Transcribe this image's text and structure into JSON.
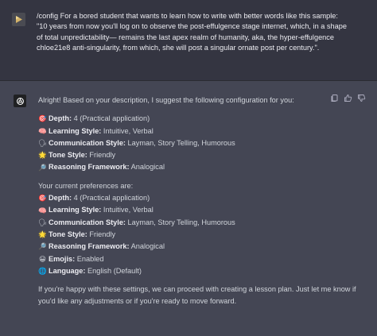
{
  "user_message": {
    "text": "/config For a bored student that wants to learn how to write with better words like this sample: \"10 years from now you'll log on to observe the post-effulgence stage internet, which, in a shape of total unpredictability— remains the last apex realm of humanity, aka, the hyper-effulgence chloe21e8 anti-singularity, from which, she will post a singular ornate post per century.\"."
  },
  "assistant_message": {
    "intro": "Alright! Based on your description, I suggest the following configuration for you:",
    "suggested": [
      {
        "emoji": "🎯",
        "icon": "target-icon",
        "label": "Depth:",
        "value": " 4 (Practical application)"
      },
      {
        "emoji": "🧠",
        "icon": "brain-icon",
        "label": "Learning Style:",
        "value": " Intuitive, Verbal"
      },
      {
        "emoji": "🗣",
        "icon": "speech-bubble-icon",
        "label": "Communication Style:",
        "value": " Layman, Story Telling, Humorous"
      },
      {
        "emoji": "🌟",
        "icon": "star-icon",
        "label": "Tone Style:",
        "value": " Friendly"
      },
      {
        "emoji": "🔎",
        "icon": "magnifier-icon",
        "label": "Reasoning Framework:",
        "value": " Analogical"
      }
    ],
    "current_heading": "Your current preferences are:",
    "current": [
      {
        "emoji": "🎯",
        "icon": "target-icon",
        "label": "Depth:",
        "value": " 4 (Practical application)"
      },
      {
        "emoji": "🧠",
        "icon": "brain-icon",
        "label": "Learning Style:",
        "value": " Intuitive, Verbal"
      },
      {
        "emoji": "🗣",
        "icon": "speech-bubble-icon",
        "label": "Communication Style:",
        "value": " Layman, Story Telling, Humorous"
      },
      {
        "emoji": "🌟",
        "icon": "star-icon",
        "label": "Tone Style:",
        "value": " Friendly"
      },
      {
        "emoji": "🔎",
        "icon": "magnifier-icon",
        "label": "Reasoning Framework:",
        "value": " Analogical"
      },
      {
        "emoji": "😀",
        "icon": "smiley-icon",
        "label": "Emojis:",
        "value": " Enabled"
      },
      {
        "emoji": "🌐",
        "icon": "globe-icon",
        "label": "Language:",
        "value": " English (Default)"
      }
    ],
    "closing": "If you're happy with these settings, we can proceed with creating a lesson plan. Just let me know if you'd like any adjustments or if you're ready to move forward."
  },
  "colors": {
    "user_bg": "#343541",
    "assistant_bg": "#444654",
    "text": "#d1d5db"
  }
}
